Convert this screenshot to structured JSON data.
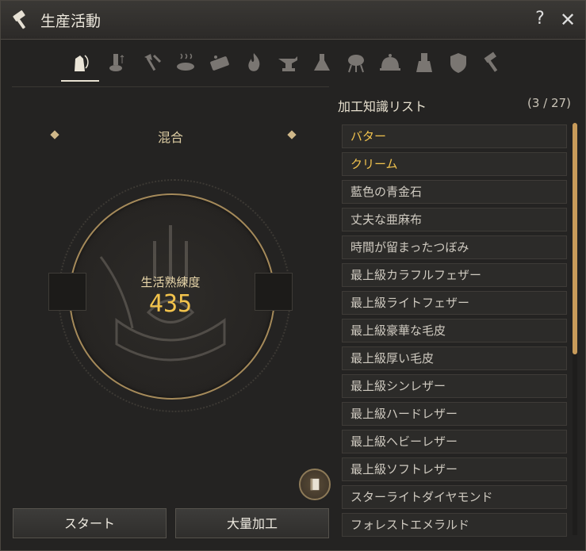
{
  "window": {
    "title": "生産活動",
    "help_label": "?",
    "close_label": "✕",
    "title_icon": "hammer-icon"
  },
  "tabs": [
    {
      "icon": "bottle-mix-icon",
      "selected": true
    },
    {
      "icon": "tool-heat-icon"
    },
    {
      "icon": "axe-icon"
    },
    {
      "icon": "steam-cook-icon"
    },
    {
      "icon": "grinder-icon"
    },
    {
      "icon": "fire-icon"
    },
    {
      "icon": "anvil-icon"
    },
    {
      "icon": "flask-icon"
    },
    {
      "icon": "grill-icon"
    },
    {
      "icon": "cloche-icon"
    },
    {
      "icon": "lab-icon"
    },
    {
      "icon": "crest-icon"
    },
    {
      "icon": "hammer-icon"
    }
  ],
  "process": {
    "recipe_name": "混合",
    "skill_label": "生活熟練度",
    "skill_value": "435"
  },
  "buttons": {
    "start_label": "スタート",
    "bulk_label": "大量加工"
  },
  "knowledge": {
    "title": "加工知識リスト",
    "count": "(3 / 27)",
    "items": [
      {
        "label": "バター",
        "highlighted": true
      },
      {
        "label": "クリーム",
        "highlighted": true
      },
      {
        "label": "藍色の青金石"
      },
      {
        "label": "丈夫な亜麻布"
      },
      {
        "label": "時間が留まったつぼみ"
      },
      {
        "label": "最上級カラフルフェザー"
      },
      {
        "label": "最上級ライトフェザー"
      },
      {
        "label": "最上級豪華な毛皮"
      },
      {
        "label": "最上級厚い毛皮"
      },
      {
        "label": "最上級シンレザー"
      },
      {
        "label": "最上級ハードレザー"
      },
      {
        "label": "最上級ヘビーレザー"
      },
      {
        "label": "最上級ソフトレザー"
      },
      {
        "label": "スターライトダイヤモンド"
      },
      {
        "label": "フォレストエメラルド"
      }
    ]
  },
  "colors": {
    "accent_gold": "#f2c34c",
    "scroll_thumb": "#c89b5a",
    "highlight_text": "#f0c24e"
  }
}
